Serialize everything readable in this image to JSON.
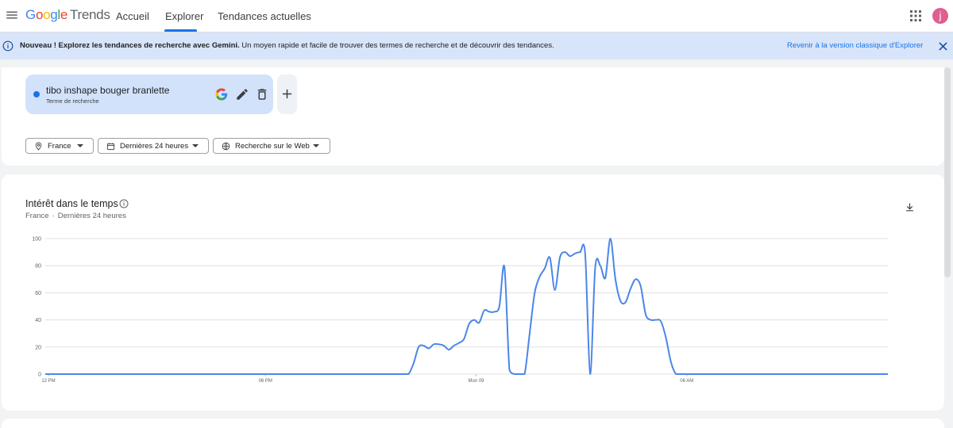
{
  "header": {
    "logo_google": "Google",
    "logo_trends": "Trends",
    "nav": [
      {
        "label": "Accueil"
      },
      {
        "label": "Explorer"
      },
      {
        "label": "Tendances actuelles"
      }
    ],
    "avatar_letter": "j"
  },
  "banner": {
    "bold_text": "Nouveau ! Explorez les tendances de recherche avec Gemini.",
    "text": " Un moyen rapide et facile de trouver des termes de recherche et de découvrir des tendances.",
    "link": "Revenir à la version classique d'Explorer"
  },
  "term": {
    "name": "tibo inshape bouger branlette",
    "subtitle": "Terme de recherche",
    "color": "#1a73e8"
  },
  "filters": {
    "region": "France",
    "period": "Dernières 24 heures",
    "type": "Recherche sur le Web"
  },
  "chart_card": {
    "title": "Intérêt dans le temps",
    "sub_region": "France",
    "sub_sep": "·",
    "sub_period": "Dernières 24 heures"
  },
  "chart_data": {
    "type": "line",
    "title": "Intérêt dans le temps",
    "ylim": [
      0,
      100
    ],
    "yticks": [
      "0",
      "20",
      "40",
      "60",
      "80",
      "100"
    ],
    "xtick_labels": [
      {
        "label": "12 PM",
        "at": 0
      },
      {
        "label": "06 PM",
        "at": 0.25
      },
      {
        "label": "Mon 09",
        "at": 0.5
      },
      {
        "label": "06 AM",
        "at": 0.75
      }
    ],
    "grid": true,
    "series": [
      {
        "color": "#4a86e8",
        "values": [
          0,
          0,
          0,
          0,
          0,
          0,
          0,
          0,
          0,
          0,
          0,
          0,
          0,
          0,
          0,
          0,
          0,
          0,
          0,
          0,
          0,
          0,
          0,
          0,
          0,
          0,
          0,
          0,
          0,
          0,
          0,
          0,
          0,
          0,
          0,
          0,
          0,
          0,
          0,
          0,
          0,
          0,
          0,
          0,
          0,
          0,
          0,
          0,
          0,
          0,
          0,
          0,
          0,
          0,
          0,
          0,
          0,
          0,
          0,
          0,
          0,
          0,
          0,
          0,
          0,
          0,
          0,
          0,
          0,
          0,
          0,
          0,
          0,
          8,
          20,
          21,
          19,
          22,
          22,
          21,
          18,
          21,
          23,
          26,
          37,
          40,
          38,
          47,
          46,
          46,
          50,
          79,
          3,
          0,
          0,
          0,
          30,
          60,
          72,
          78,
          86,
          62,
          86,
          90,
          87,
          89,
          90,
          89,
          0,
          79,
          80,
          71,
          100,
          70,
          54,
          53,
          63,
          70,
          65,
          44,
          40,
          40,
          39,
          27,
          9,
          0,
          0,
          0,
          0,
          0,
          0,
          0,
          0,
          0,
          0,
          0,
          0,
          0,
          0,
          0,
          0,
          0,
          0,
          0,
          0,
          0,
          0,
          0,
          0,
          0,
          0,
          0,
          0,
          0,
          0,
          0,
          0,
          0,
          0,
          0,
          0,
          0,
          0,
          0,
          0,
          0,
          0,
          0
        ]
      }
    ]
  }
}
